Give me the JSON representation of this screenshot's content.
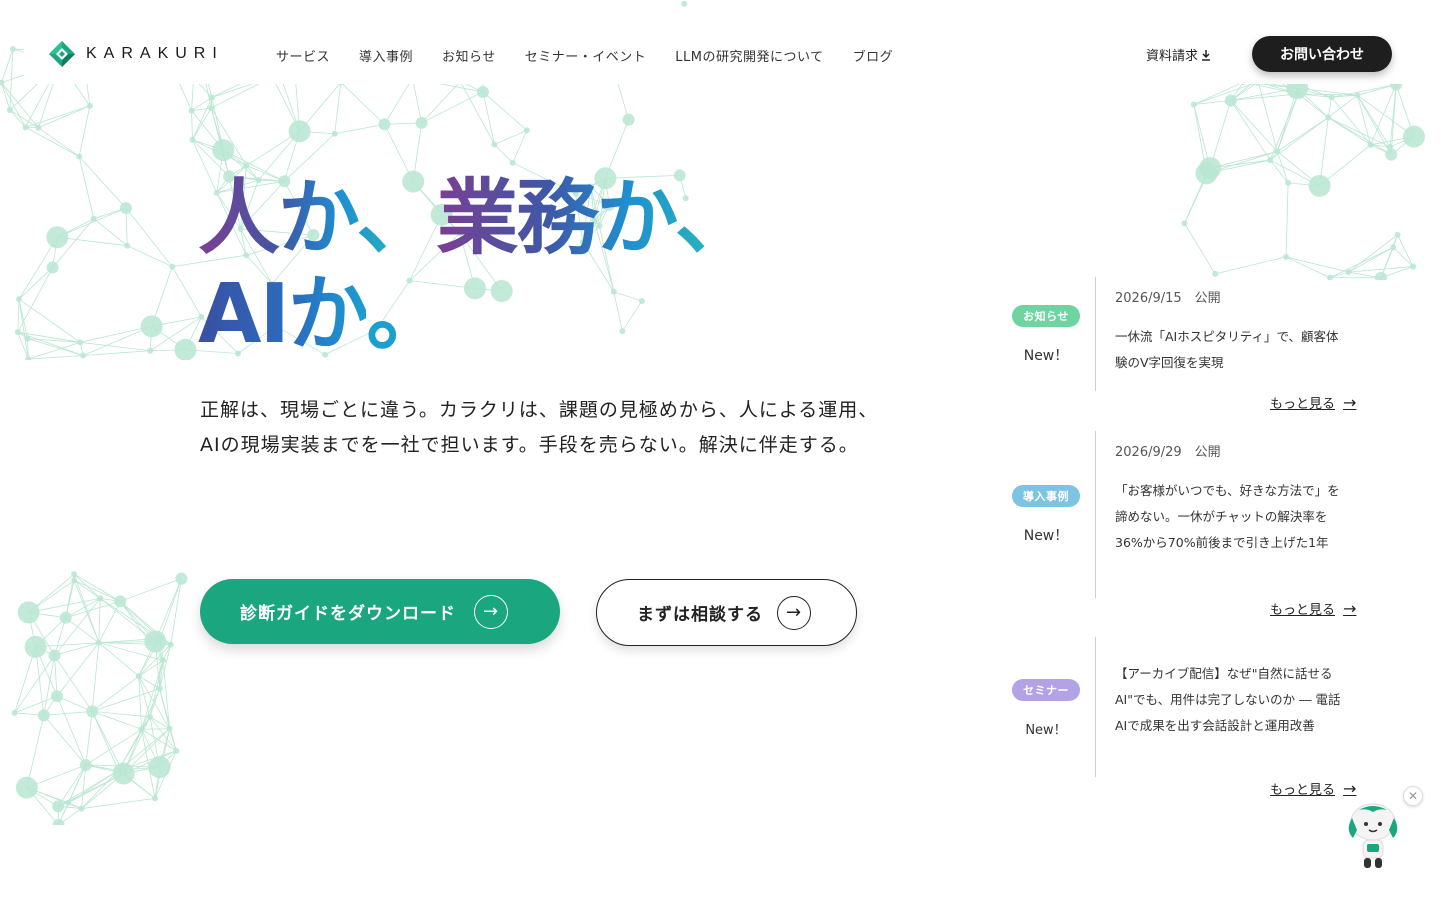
{
  "brand": {
    "name": "KARAKURI"
  },
  "nav": {
    "items": [
      {
        "label": "サービス"
      },
      {
        "label": "導入事例"
      },
      {
        "label": "お知らせ"
      },
      {
        "label": "セミナー・イベント"
      },
      {
        "label": "LLMの研究開発について"
      },
      {
        "label": "ブログ"
      }
    ]
  },
  "header": {
    "doc_request": "資料請求",
    "contact": "お問い合わせ"
  },
  "hero": {
    "line1_part1": "人か、",
    "line1_part2": "業務か、",
    "line2_part1": "AIか",
    "line2_part2": "。",
    "lead": "正解は、現場ごとに違う。カラクリは、課題の見極めから、人による運用、AIの現場実装までを一社で担います。手段を売らない。解決に伴走する。",
    "cta_primary": "診断ガイドをダウンロード",
    "cta_secondary": "まずは相談する"
  },
  "news": [
    {
      "badge": "お知らせ",
      "badge_color": "#6fd3a2",
      "new_label": "New！",
      "date": "2026/9/15　公開",
      "title": "一休流「AIホスピタリティ」で、顧客体験のV字回復を実現",
      "more": "もっと見る"
    },
    {
      "badge": "導入事例",
      "badge_color": "#7cc4e2",
      "new_label": "New！",
      "date": "2026/9/29　公開",
      "title": "「お客様がいつでも、好きな方法で」を諦めない。一休がチャットの解決率を36%から70%前後まで引き上げた1年",
      "more": "もっと見る"
    },
    {
      "badge": "セミナー",
      "badge_color": "#b3a3e6",
      "new_label": "New！",
      "date": "",
      "title": "【アーカイブ配信】なぜ\"自然に話せるAI\"でも、用件は完了しないのか ― 電話AIで成果を出す会話設計と運用改善",
      "more": "もっと見る"
    }
  ],
  "colors": {
    "primary_green": "#1aa67e",
    "dark": "#1e1e1e",
    "network": "#b9e6d2"
  },
  "icons": {
    "download": "download-icon",
    "arrow": "arrow-right-icon",
    "close": "close-icon"
  }
}
